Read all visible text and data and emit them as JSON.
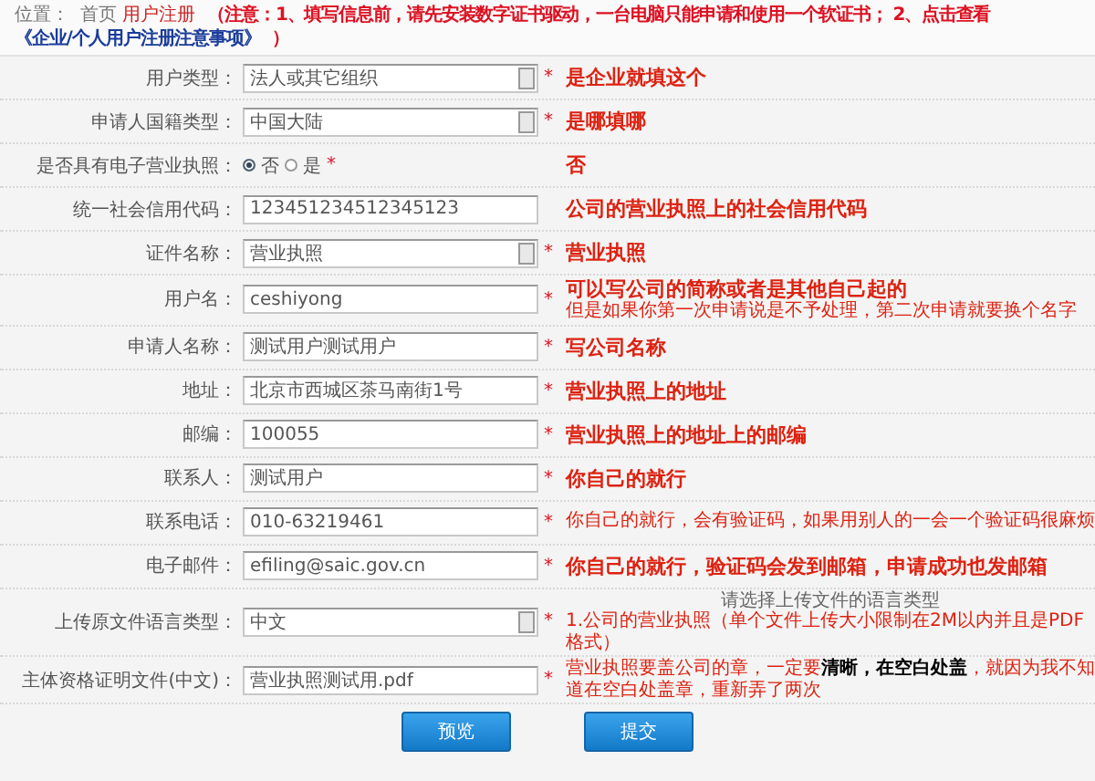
{
  "breadcrumb": {
    "prefix": "位置：",
    "items": [
      {
        "label": "首页",
        "selected": false
      },
      {
        "label": "用户注册",
        "selected": true
      }
    ]
  },
  "notice": {
    "text": "（注意：1、填写信息前，请先安装数字证书驱动，一台电脑只能申请和使用一个软证书； 2、点击查看",
    "link": "《企业/个人用户注册注意事项》",
    "close": "）"
  },
  "fields": [
    {
      "label": "用户类型：",
      "kind": "select",
      "value": "法人或其它组织",
      "mark": "*",
      "notes": [
        {
          "kind": "big",
          "text": "是企业就填这个"
        }
      ]
    },
    {
      "label": "申请人国籍类型：",
      "kind": "select",
      "value": "中国大陆",
      "mark": "*",
      "notes": [
        {
          "kind": "big",
          "text": "是哪填哪"
        }
      ]
    },
    {
      "label": "是否具有电子营业执照：",
      "kind": "radio",
      "options": [
        {
          "label": "否",
          "selected": true
        },
        {
          "label": "是",
          "selected": false
        }
      ],
      "mark": "*",
      "notes": [
        {
          "kind": "big",
          "text": "否"
        }
      ]
    },
    {
      "label": "统一社会信用代码：",
      "kind": "text",
      "value": "123451234512345123",
      "notes": [
        {
          "kind": "big",
          "text": "公司的营业执照上的社会信用代码"
        }
      ]
    },
    {
      "label": "证件名称：",
      "kind": "select",
      "value": "营业执照",
      "mark": "*",
      "notes": [
        {
          "kind": "big",
          "text": "营业执照"
        }
      ]
    },
    {
      "label": "用户名：",
      "kind": "text",
      "value": "ceshiyong",
      "mark": "*",
      "notes": [
        {
          "kind": "big",
          "text": "可以写公司的简称或者是其他自己起的"
        },
        {
          "kind": "small",
          "text": "但是如果你第一次申请说是不予处理，第二次申请就要换个名字"
        }
      ]
    },
    {
      "label": "申请人名称：",
      "kind": "text",
      "value": "测试用户测试用户",
      "mark": "*",
      "notes": [
        {
          "kind": "big",
          "text": "写公司名称"
        }
      ]
    },
    {
      "label": "地址：",
      "kind": "text",
      "value": "北京市西城区茶马南街1号",
      "mark": "*",
      "notes": [
        {
          "kind": "big",
          "text": "营业执照上的地址"
        }
      ]
    },
    {
      "label": "邮编：",
      "kind": "text",
      "value": "100055",
      "mark": "*",
      "notes": [
        {
          "kind": "big",
          "text": "营业执照上的地址上的邮编"
        }
      ]
    },
    {
      "label": "联系人：",
      "kind": "text",
      "value": "测试用户",
      "mark": "*",
      "notes": [
        {
          "kind": "big",
          "text": "你自己的就行"
        }
      ]
    },
    {
      "label": "联系电话：",
      "kind": "text",
      "value": "010-63219461",
      "mark": "*",
      "notes": [
        {
          "kind": "small",
          "text": "你自己的就行，会有验证码，如果用别人的一会一个验证码很麻烦"
        }
      ]
    },
    {
      "label": "电子邮件：",
      "kind": "text",
      "value": "efiling@saic.gov.cn",
      "mark": "*",
      "notes": [
        {
          "kind": "big",
          "text": "你自己的就行，验证码会发到邮箱，申请成功也发邮箱"
        }
      ]
    },
    {
      "label": "上传原文件语言类型：",
      "kind": "select",
      "value": "中文",
      "mark": "*",
      "notes": [
        {
          "kind": "hint",
          "text": "请选择上传文件的语言类型"
        },
        {
          "kind": "small",
          "text": "1.公司的营业执照（单个文件上传大小限制在2M以内并且是PDF格式）"
        }
      ]
    },
    {
      "label": "主体资格证明文件(中文)：",
      "kind": "text",
      "value": "营业执照测试用.pdf",
      "mark": "*",
      "notes": [
        {
          "kind": "small",
          "text": "营业执照要盖公司的章，一定要**清晰，在空白处盖**，就因为我不知道在空白处盖章，重新弄了两次"
        }
      ]
    }
  ],
  "buttons": [
    "预览",
    "提交"
  ]
}
